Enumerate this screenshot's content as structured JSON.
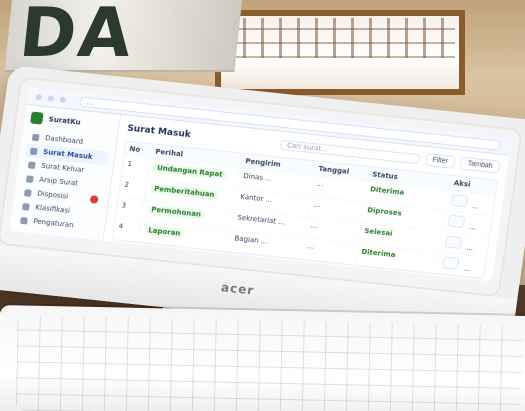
{
  "scene": {
    "wall_sign_text": "DA"
  },
  "monitor": {
    "brand": "acer"
  },
  "browser": {
    "address": "..."
  },
  "app": {
    "name": "SuratKu",
    "sidebar": {
      "items": [
        {
          "label": "Dashboard"
        },
        {
          "label": "Surat Masuk"
        },
        {
          "label": "Surat Keluar"
        },
        {
          "label": "Arsip Surat"
        },
        {
          "label": "Disposisi"
        },
        {
          "label": "Klasifikasi"
        },
        {
          "label": "Pengaturan"
        }
      ]
    },
    "main": {
      "title": "Surat Masuk",
      "search_placeholder": "Cari surat...",
      "add_button": "Tambah",
      "filter_button": "Filter",
      "table": {
        "headers": [
          "No",
          "Perihal",
          "Pengirim",
          "Tanggal",
          "Status",
          "Aksi"
        ],
        "rows": [
          {
            "no": "1",
            "perihal": "Undangan Rapat",
            "pengirim": "Dinas ...",
            "tanggal": "…",
            "status": "Diterima"
          },
          {
            "no": "2",
            "perihal": "Pemberitahuan",
            "pengirim": "Kantor ...",
            "tanggal": "…",
            "status": "Diproses"
          },
          {
            "no": "3",
            "perihal": "Permohonan",
            "pengirim": "Sekretariat ...",
            "tanggal": "…",
            "status": "Selesai"
          },
          {
            "no": "4",
            "perihal": "Laporan",
            "pengirim": "Bagian ...",
            "tanggal": "…",
            "status": "Diterima"
          }
        ]
      }
    }
  }
}
